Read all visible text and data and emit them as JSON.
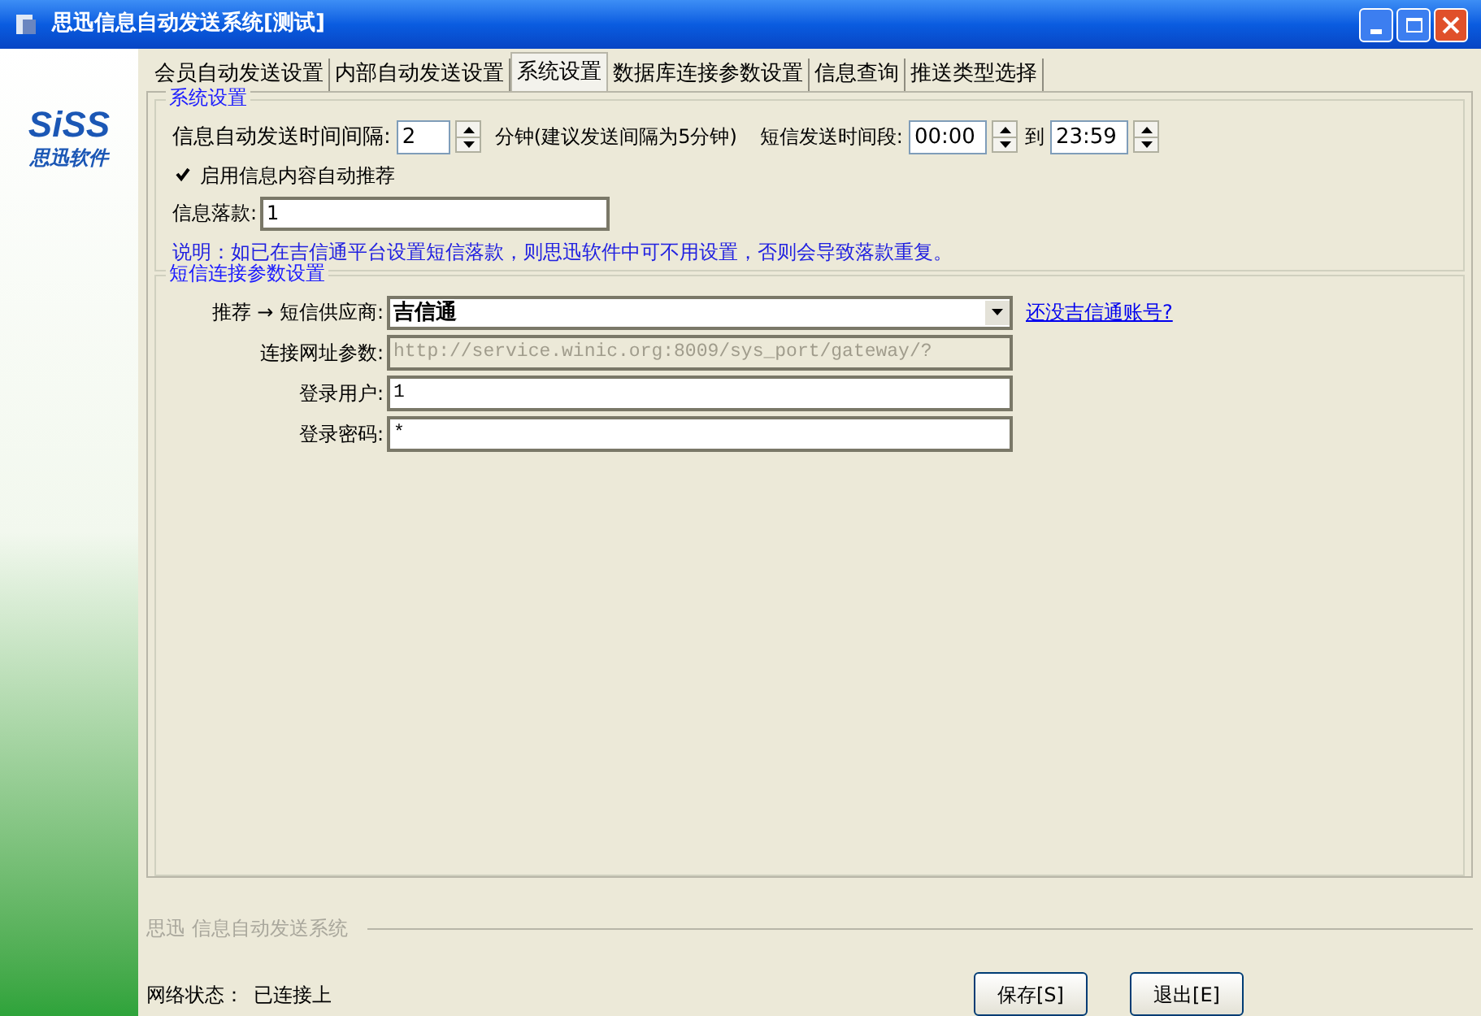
{
  "window": {
    "title": "思迅信息自动发送系统[测试]"
  },
  "sidebar": {
    "logo": "SiSS",
    "logo_caption": "思迅软件"
  },
  "tabs": [
    {
      "label": "会员自动发送设置",
      "selected": false
    },
    {
      "label": "内部自动发送设置",
      "selected": false
    },
    {
      "label": "系统设置",
      "selected": true
    },
    {
      "label": "数据库连接参数设置",
      "selected": false
    },
    {
      "label": "信息查询",
      "selected": false
    },
    {
      "label": "推送类型选择",
      "selected": false
    }
  ],
  "system_settings": {
    "title": "系统设置",
    "interval_label": "信息自动发送时间间隔:",
    "interval_value": "2",
    "interval_unit": "分钟(建议发送间隔为5分钟)",
    "period_label": "短信发送时间段:",
    "period_start": "00:00",
    "period_to": "到",
    "period_end": "23:59",
    "auto_recommend": {
      "label": "启用信息内容自动推荐",
      "checked": true
    },
    "signature_label": "信息落款:",
    "signature_value": "1",
    "note": "说明：如已在吉信通平台设置短信落款，则思迅软件中可不用设置，否则会导致落款重复。"
  },
  "sms_settings": {
    "title": "短信连接参数设置",
    "provider_label": "推荐 → 短信供应商:",
    "provider_value": "吉信通",
    "signup_link": "还没吉信通账号?",
    "fields": [
      {
        "label": "连接网址参数:",
        "value": "http://service.winic.org:8009/sys_port/gateway/?",
        "disabled": true
      },
      {
        "label": "登录用户:",
        "value": "1",
        "disabled": false
      },
      {
        "label": "登录密码:",
        "value": "*",
        "disabled": false
      }
    ]
  },
  "footer": {
    "caption": "思迅 信息自动发送系统",
    "status_label": "网络状态：",
    "status_value": "已连接上",
    "buttons": [
      "保存[S]",
      "退出[E]"
    ]
  }
}
